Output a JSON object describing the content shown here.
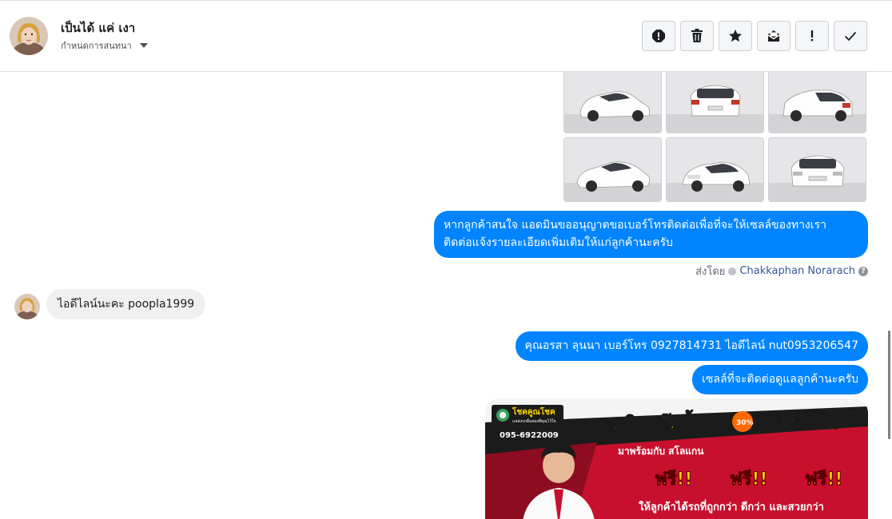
{
  "header": {
    "contact_name": "เป็นได้ แค่ เงา",
    "assign_label": "กำหนดการสนทนา",
    "toolbar": [
      {
        "name": "spam-icon",
        "glyph": "!"
      },
      {
        "name": "trash-icon",
        "glyph": ""
      },
      {
        "name": "star-icon",
        "glyph": ""
      },
      {
        "name": "mark-unread-icon",
        "glyph": ""
      },
      {
        "name": "follow-up-icon",
        "glyph": "!"
      },
      {
        "name": "done-check-icon",
        "glyph": ""
      }
    ]
  },
  "messages": {
    "out_1_line1": "หากลูกค้าสนใจ แอดมินขออนุญาตขอเบอร์โทรติดต่อเพื่อที่จะให้เซลล์ของทางเรา",
    "out_1_line2": "ติดต่อแจ้งรายละเอียดเพิ่มเติมให้แก่ลูกค้านะครับ",
    "sent_by_label": "ส่งโดย",
    "sent_by_name": "Chakkaphan Norarach",
    "in_1": "ไอดีไลน์นะคะ  poopla1999",
    "out_2": "คุณอรสา ลุนนา      เบอร์โทร 0927814731  ไอดีไลน์ nut0953206547",
    "out_3": "เซลล์ที่จะติดต่อดูแลลูกค้านะครับ"
  },
  "banner": {
    "brand": "โชคคูณโชค",
    "brand_sub": "แหล่งรถมือสองที่คุณไว้ใจ",
    "phone": "095-6922009",
    "headline": "แอดมินแจ๊คกี้",
    "headline_tag": "โปรระเบิด",
    "sub": "มาพร้อมกับ สโลแกน",
    "free": "ฟรี!!",
    "tagline": "ให้ลูกค้าได้รถที่ถูกกว่า ดีกว่า และสวยกว่า"
  },
  "colors": {
    "messenger_blue": "#0084ff",
    "incoming_gray": "#f1f0f0",
    "banner_red": "#c8102e",
    "banner_yellow": "#ffd400"
  }
}
